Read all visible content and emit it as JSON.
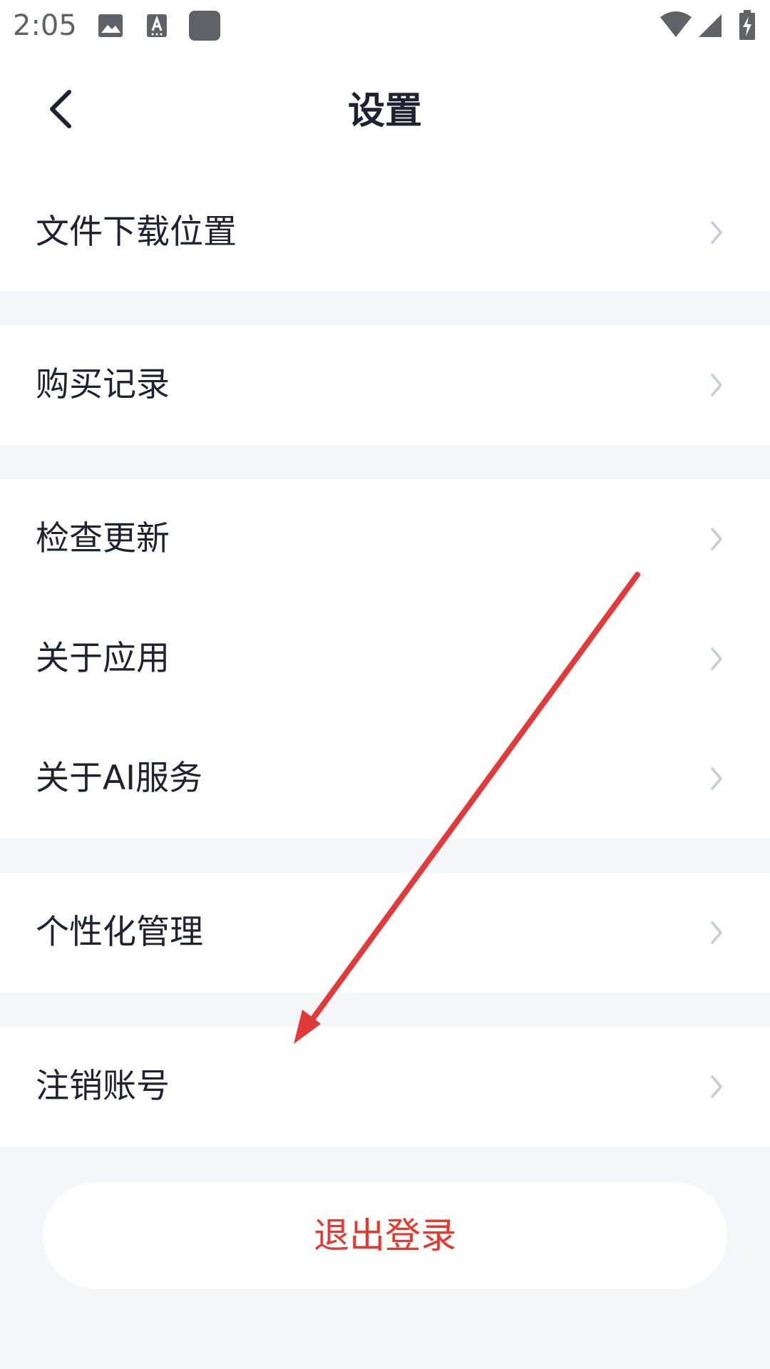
{
  "status_bar": {
    "time": "2:05",
    "icons": [
      "image-icon",
      "keyboard-icon",
      "app-icon",
      "wifi-icon",
      "signal-icon",
      "battery-charging-icon"
    ]
  },
  "header": {
    "title": "设置",
    "back_icon": "chevron-left-icon"
  },
  "settings": {
    "groups": [
      {
        "items": [
          {
            "label": "文件下载位置"
          }
        ]
      },
      {
        "items": [
          {
            "label": "购买记录"
          }
        ]
      },
      {
        "items": [
          {
            "label": "检查更新"
          },
          {
            "label": "关于应用"
          },
          {
            "label": "关于AI服务"
          }
        ]
      },
      {
        "items": [
          {
            "label": "个性化管理"
          }
        ]
      },
      {
        "items": [
          {
            "label": "注销账号"
          }
        ]
      }
    ]
  },
  "logout": {
    "label": "退出登录",
    "color": "#e5392f"
  },
  "colors": {
    "background": "#f5f6fa",
    "surface": "#ffffff",
    "text": "#1f2230",
    "chevron": "#c8ccd6",
    "annotation_arrow": "#e03a3a"
  }
}
